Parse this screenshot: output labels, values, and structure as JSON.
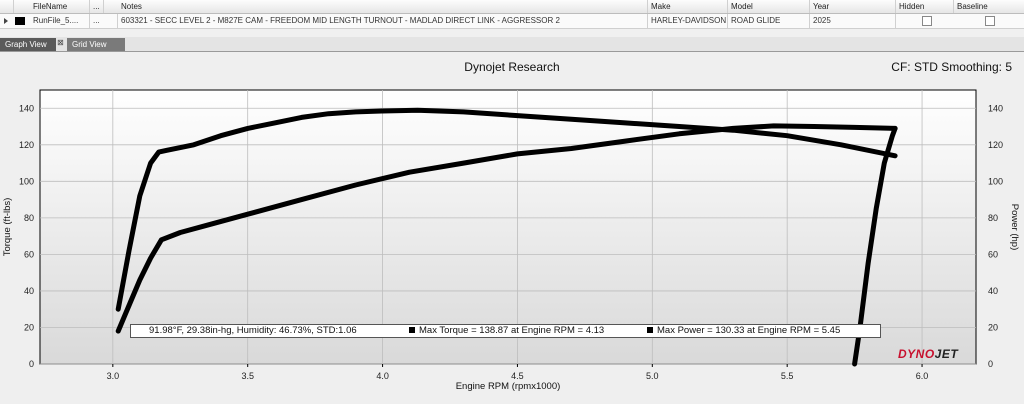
{
  "grid": {
    "columns": [
      "FileName",
      "...",
      "Notes",
      "Make",
      "Model",
      "Year",
      "Hidden",
      "Baseline"
    ],
    "dots": "...",
    "row": {
      "filename": "RunFile_5....",
      "dots": "...",
      "notes": "603321 - SECC LEVEL 2 - M827E CAM - FREEDOM MID LENGTH TURNOUT - MADLAD DIRECT LINK - AGGRESSOR 2",
      "make": "HARLEY-DAVIDSON",
      "model": "ROAD GLIDE",
      "year": "2025"
    }
  },
  "tabs": [
    {
      "label": "Graph View",
      "active": true
    },
    {
      "label": "Grid View",
      "active": false
    }
  ],
  "tab_close": "⊠",
  "header": {
    "title": "Dynojet Research",
    "cf": "CF: STD Smoothing: 5"
  },
  "annotation": {
    "conditions": "91.98°F, 29.38in-hg, Humidity: 46.73%, STD:1.06",
    "max_torque": "Max Torque = 138.87 at Engine RPM = 4.13",
    "max_power": "Max Power = 130.33 at Engine RPM = 5.45"
  },
  "logo": {
    "dyno": "DYNO",
    "jet": "JET"
  },
  "chart_data": {
    "type": "line",
    "xlabel": "Engine RPM (rpmx1000)",
    "ylabel": "Torque (ft-lbs)",
    "y2label": "Power (hp)",
    "xlim": [
      2.73,
      6.2
    ],
    "ylim": [
      0,
      150
    ],
    "y2lim": [
      0,
      150
    ],
    "xticks": [
      "3.0",
      "3.5",
      "4.0",
      "4.5",
      "5.0",
      "5.5",
      "6.0"
    ],
    "xtick_values": [
      3.0,
      3.5,
      4.0,
      4.5,
      5.0,
      5.5,
      6.0
    ],
    "yticks": [
      "0",
      "20",
      "40",
      "60",
      "80",
      "100",
      "120",
      "140"
    ],
    "ytick_values": [
      0,
      20,
      40,
      60,
      80,
      100,
      120,
      140
    ],
    "grid": true,
    "series": [
      {
        "color": "#000000",
        "x": [
          3.02,
          3.06,
          3.1,
          3.14,
          3.17,
          3.2,
          3.3,
          3.4,
          3.5,
          3.6,
          3.7,
          3.8,
          3.9,
          4.0,
          4.13,
          4.3,
          4.5,
          4.7,
          4.9,
          5.1,
          5.3,
          5.5,
          5.7,
          5.9
        ],
        "values": [
          30,
          62,
          92,
          110,
          116,
          117,
          120,
          125,
          129,
          132,
          135,
          137,
          138,
          138.5,
          138.87,
          138,
          136,
          134,
          132,
          130,
          128,
          125,
          120,
          114
        ]
      },
      {
        "color": "#000000",
        "x": [
          3.02,
          3.06,
          3.1,
          3.14,
          3.18,
          3.25,
          3.35,
          3.5,
          3.7,
          3.9,
          4.1,
          4.3,
          4.5,
          4.7,
          4.9,
          5.1,
          5.3,
          5.45,
          5.6,
          5.75,
          5.9
        ],
        "values": [
          18,
          32,
          46,
          58,
          68,
          72,
          76,
          82,
          90,
          98,
          105,
          110,
          115,
          118,
          122,
          126,
          129,
          130.33,
          130,
          129.5,
          129
        ]
      },
      {
        "color": "#000000",
        "x": [
          5.75,
          5.77,
          5.8,
          5.83,
          5.86,
          5.89,
          5.9
        ],
        "values": [
          0,
          20,
          55,
          85,
          110,
          125,
          129
        ]
      }
    ]
  }
}
